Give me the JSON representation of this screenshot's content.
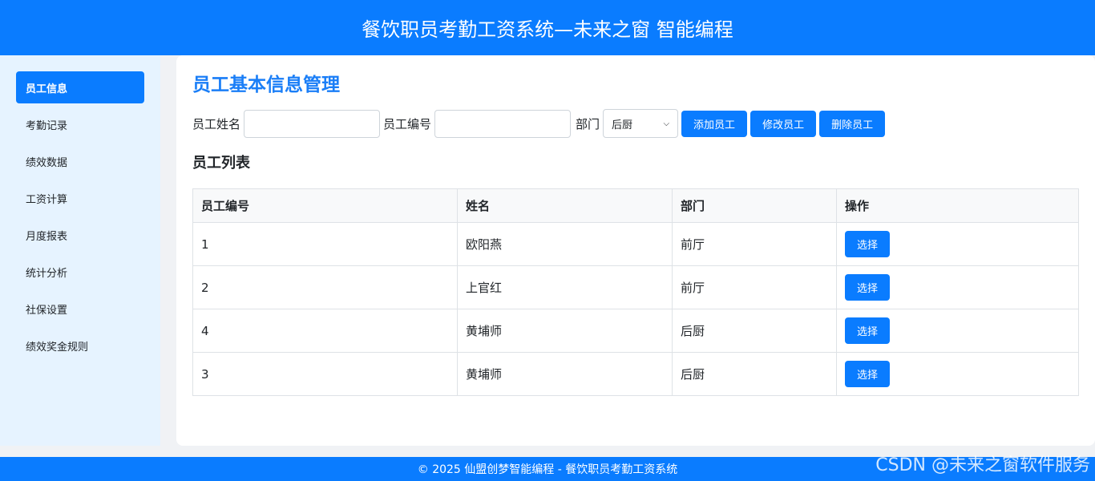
{
  "header": {
    "title": "餐饮职员考勤工资系统—未来之窗 智能编程"
  },
  "sidebar": {
    "items": [
      {
        "label": "员工信息",
        "active": true
      },
      {
        "label": "考勤记录"
      },
      {
        "label": "绩效数据"
      },
      {
        "label": "工资计算"
      },
      {
        "label": "月度报表"
      },
      {
        "label": "统计分析"
      },
      {
        "label": "社保设置"
      },
      {
        "label": "绩效奖金规则"
      }
    ]
  },
  "main": {
    "title": "员工基本信息管理",
    "form": {
      "name_label": "员工姓名",
      "name_value": "",
      "id_label": "员工编号",
      "id_value": "",
      "dept_label": "部门",
      "dept_selected": "后厨",
      "add_label": "添加员工",
      "edit_label": "修改员工",
      "delete_label": "删除员工"
    },
    "list_title": "员工列表",
    "table": {
      "headers": [
        "员工编号",
        "姓名",
        "部门",
        "操作"
      ],
      "rows": [
        {
          "id": "1",
          "name": "欧阳燕",
          "dept": "前厅",
          "action": "选择"
        },
        {
          "id": "2",
          "name": "上官红",
          "dept": "前厅",
          "action": "选择"
        },
        {
          "id": "4",
          "name": "黄埔师",
          "dept": "后厨",
          "action": "选择"
        },
        {
          "id": "3",
          "name": "黄埔师",
          "dept": "后厨",
          "action": "选择"
        }
      ]
    }
  },
  "footer": {
    "text": "© 2025 仙盟创梦智能编程 - 餐饮职员考勤工资系统"
  },
  "watermark": "CSDN @未来之窗软件服务",
  "colors": {
    "primary": "#0a7cff",
    "sidebar_bg": "#e6f3ff",
    "title": "#1a7ef7"
  }
}
